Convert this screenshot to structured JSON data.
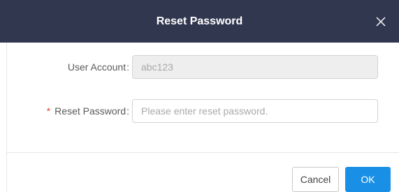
{
  "dialog": {
    "title": "Reset Password",
    "close_glyph": "X",
    "fields": {
      "user_account": {
        "label": "User Account",
        "colon": ":",
        "value": "abc123"
      },
      "reset_password": {
        "required_mark": "*",
        "label": "Reset Password",
        "colon": ":",
        "placeholder": "Please enter reset password."
      }
    },
    "buttons": {
      "cancel_label": "Cancel",
      "ok_label": "OK"
    }
  },
  "colors": {
    "header_bg": "#323750",
    "primary": "#1a8fe6",
    "required": "#e8472b"
  }
}
